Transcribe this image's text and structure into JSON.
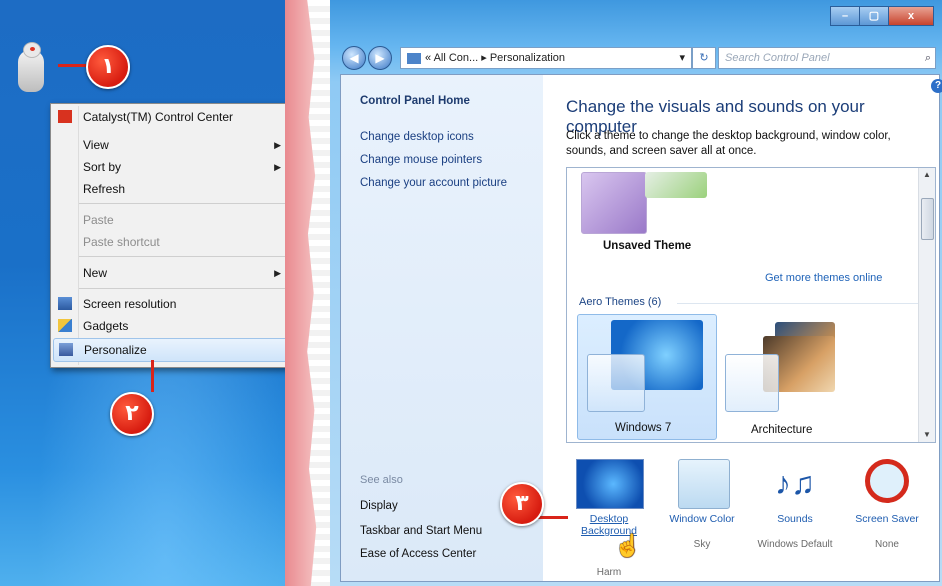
{
  "steps": {
    "one": "١",
    "two": "٢",
    "three": "٣"
  },
  "context_menu": {
    "catalyst": "Catalyst(TM) Control Center",
    "view": "View",
    "sort_by": "Sort by",
    "refresh": "Refresh",
    "paste": "Paste",
    "paste_shortcut": "Paste shortcut",
    "new": "New",
    "screen_resolution": "Screen resolution",
    "gadgets": "Gadgets",
    "personalize": "Personalize",
    "submenu_arrow": "▶"
  },
  "window": {
    "minimize": "–",
    "maximize": "▢",
    "close": "x",
    "back": "◀",
    "forward": "▶",
    "address": "« All Con... ▸ Personalization",
    "address_dropdown": "▾",
    "refresh": "↻",
    "search_placeholder": "Search Control Panel",
    "search_icon": "⌕",
    "help": "?"
  },
  "left_pane": {
    "home": "Control Panel Home",
    "links": [
      "Change desktop icons",
      "Change mouse pointers",
      "Change your account picture"
    ],
    "see_also": "See also",
    "see_also_links": [
      "Display",
      "Taskbar and Start Menu",
      "Ease of Access Center"
    ]
  },
  "main": {
    "title": "Change the visuals and sounds on your computer",
    "description": "Click a theme to change the desktop background, window color, sounds, and screen saver all at once.",
    "unsaved_theme": "Unsaved Theme",
    "get_more": "Get more themes online",
    "aero_group": "Aero Themes (6)",
    "themes": [
      "Windows 7",
      "Architecture"
    ],
    "scroll_up": "▲",
    "scroll_down": "▼"
  },
  "bottom": [
    {
      "title": "Desktop Background",
      "sub": "Harm"
    },
    {
      "title": "Window Color",
      "sub": "Sky"
    },
    {
      "title": "Sounds",
      "sub": "Windows Default"
    },
    {
      "title": "Screen Saver",
      "sub": "None"
    }
  ],
  "colors": {
    "badge_red": "#d71c10",
    "link_blue": "#1f5db0",
    "accent_blue": "#2d6fc8"
  }
}
